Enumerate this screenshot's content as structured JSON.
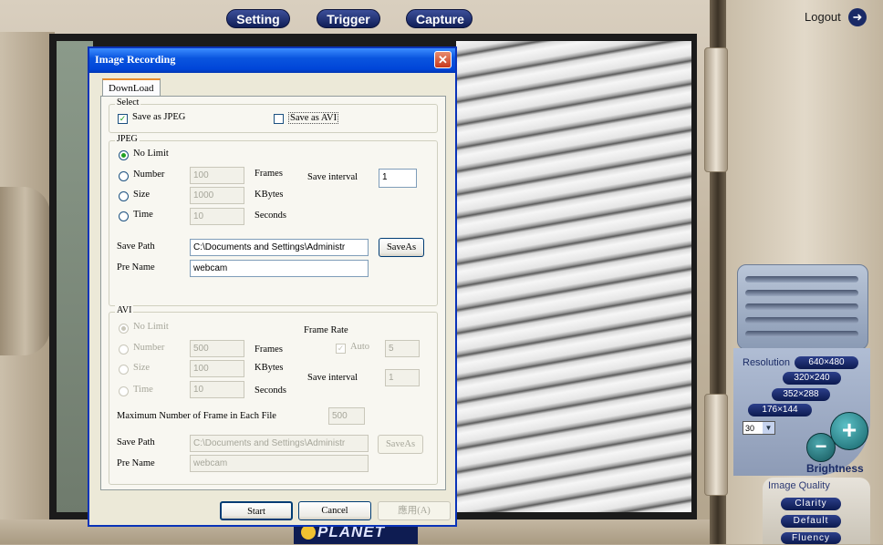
{
  "nav": {
    "setting": "Setting",
    "trigger": "Trigger",
    "capture": "Capture",
    "logout": "Logout"
  },
  "brand": {
    "logo": "PLANET"
  },
  "controls": {
    "resolution_label": "Resolution",
    "resolutions": [
      "640×480",
      "320×240",
      "352×288",
      "176×144"
    ],
    "fps_value": "30",
    "brightness_label": "Brightness",
    "image_quality_label": "Image Quality",
    "quality_options": [
      "Clarity",
      "Default",
      "Fluency"
    ]
  },
  "dialog": {
    "title": "Image Recording",
    "tab": "DownLoad",
    "select": {
      "label": "Select",
      "save_jpeg": "Save as JPEG",
      "save_jpeg_checked": true,
      "save_avi": "Save as AVI",
      "save_avi_checked": false
    },
    "jpeg": {
      "label": "JPEG",
      "no_limit": "No Limit",
      "number": "Number",
      "number_value": "100",
      "frames": "Frames",
      "size": "Size",
      "size_value": "1000",
      "kbytes": "KBytes",
      "time": "Time",
      "time_value": "10",
      "seconds": "Seconds",
      "save_interval": "Save interval",
      "save_interval_value": "1",
      "save_path": "Save Path",
      "save_path_value": "C:\\Documents and Settings\\Administr",
      "saveas": "SaveAs",
      "pre_name": "Pre Name",
      "pre_name_value": "webcam"
    },
    "avi": {
      "label": "AVI",
      "no_limit": "No Limit",
      "number": "Number",
      "number_value": "500",
      "frames": "Frames",
      "size": "Size",
      "size_value": "100",
      "kbytes": "KBytes",
      "time": "Time",
      "time_value": "10",
      "seconds": "Seconds",
      "frame_rate": "Frame Rate",
      "auto": "Auto",
      "auto_value": "5",
      "save_interval": "Save interval",
      "save_interval_value": "1",
      "max_frames": "Maximum Number of Frame in Each File",
      "max_frames_value": "500",
      "save_path": "Save Path",
      "save_path_value": "C:\\Documents and Settings\\Administr",
      "saveas": "SaveAs",
      "pre_name": "Pre Name",
      "pre_name_value": "webcam"
    },
    "buttons": {
      "start": "Start",
      "cancel": "Cancel",
      "apply": "應用(A)"
    }
  }
}
